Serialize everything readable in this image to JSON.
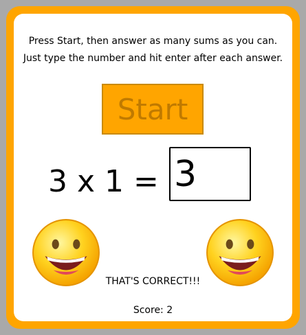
{
  "instructions": "Press Start, then answer as many sums as you can. Just type the number and hit enter after each answer.",
  "start_label": "Start",
  "question": {
    "operand_a": "3",
    "operator": "x",
    "operand_b": "1",
    "equals": "="
  },
  "answer_value": "3",
  "feedback": "THAT'S CORRECT!!!",
  "score": {
    "label": "Score:",
    "value": "2"
  },
  "colors": {
    "frame": "#ffa500",
    "background": "#a9a9a9",
    "start_text": "#c07a00"
  },
  "icons": [
    "smiley-face-icon",
    "smiley-face-icon"
  ]
}
